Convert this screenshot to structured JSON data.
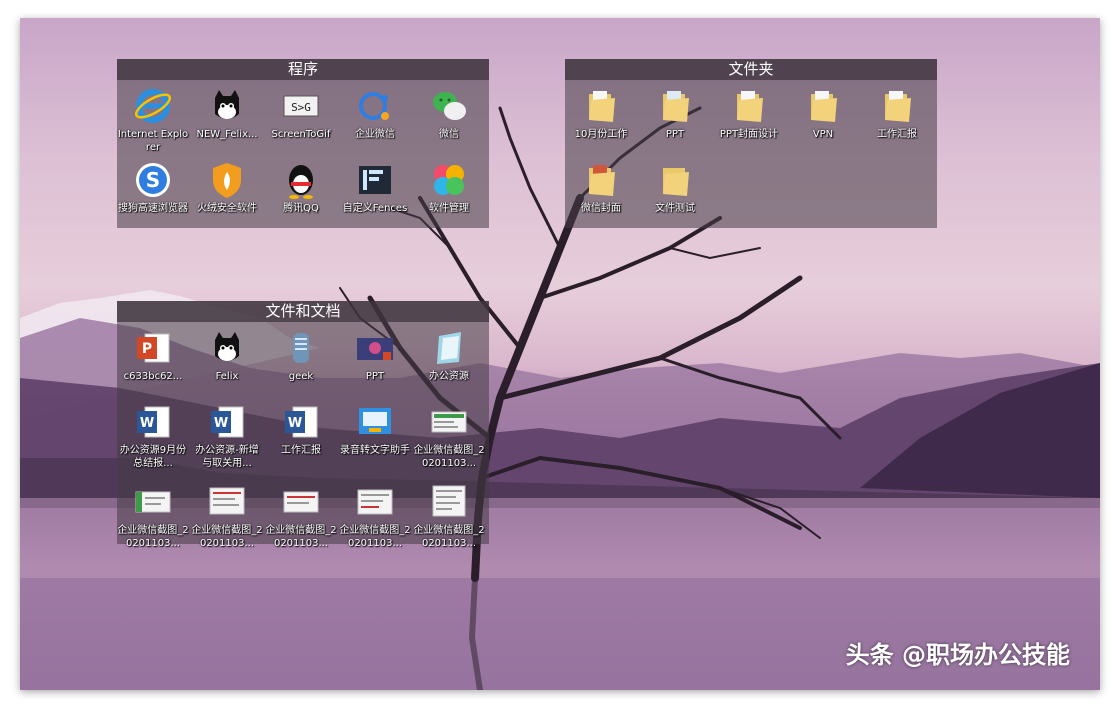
{
  "fences": {
    "programs": {
      "title": "程序",
      "items": [
        {
          "label": "Internet Explorer",
          "icon": "ie-icon"
        },
        {
          "label": "NEW_Felix...",
          "icon": "felix-cat-icon"
        },
        {
          "label": "ScreenToGif",
          "icon": "screentogif-icon"
        },
        {
          "label": "企业微信",
          "icon": "wecom-icon"
        },
        {
          "label": "微信",
          "icon": "wechat-icon"
        },
        {
          "label": "搜狗高速浏览器",
          "icon": "sogou-browser-icon"
        },
        {
          "label": "火绒安全软件",
          "icon": "huorong-shield-icon"
        },
        {
          "label": "腾讯QQ",
          "icon": "qq-penguin-icon"
        },
        {
          "label": "自定义Fences",
          "icon": "fences-icon"
        },
        {
          "label": "软件管理",
          "icon": "software-manager-icon"
        }
      ]
    },
    "folders": {
      "title": "文件夹",
      "items": [
        {
          "label": "10月份工作",
          "icon": "folder-icon"
        },
        {
          "label": "PPT",
          "icon": "folder-icon"
        },
        {
          "label": "PPT封面设计",
          "icon": "folder-icon"
        },
        {
          "label": "VPN",
          "icon": "folder-icon"
        },
        {
          "label": "工作汇报",
          "icon": "folder-icon"
        },
        {
          "label": "微信封面",
          "icon": "folder-icon"
        },
        {
          "label": "文件测试",
          "icon": "folder-icon"
        }
      ]
    },
    "documents": {
      "title": "文件和文档",
      "items": [
        {
          "label": "c633bc62...",
          "icon": "powerpoint-file-icon"
        },
        {
          "label": "Felix",
          "icon": "felix-cat-icon"
        },
        {
          "label": "geek",
          "icon": "geek-app-icon"
        },
        {
          "label": "PPT",
          "icon": "ppt-image-icon"
        },
        {
          "label": "办公资源",
          "icon": "office-resource-icon"
        },
        {
          "label": "办公资源9月份总结报...",
          "icon": "word-file-icon"
        },
        {
          "label": "办公资源-新增与取关用...",
          "icon": "word-file-icon"
        },
        {
          "label": "工作汇报",
          "icon": "word-file-icon"
        },
        {
          "label": "录音转文字助手",
          "icon": "recorder-app-icon"
        },
        {
          "label": "企业微信截图_20201103...",
          "icon": "screenshot-thumbnail-icon"
        },
        {
          "label": "企业微信截图_20201103...",
          "icon": "screenshot-thumbnail-icon"
        },
        {
          "label": "企业微信截图_20201103...",
          "icon": "screenshot-thumbnail-icon"
        },
        {
          "label": "企业微信截图_20201103...",
          "icon": "screenshot-thumbnail-icon"
        },
        {
          "label": "企业微信截图_20201103...",
          "icon": "screenshot-thumbnail-icon"
        },
        {
          "label": "企业微信截图_20201103...",
          "icon": "screenshot-thumbnail-icon"
        }
      ]
    }
  },
  "watermark": "头条 @职场办公技能"
}
